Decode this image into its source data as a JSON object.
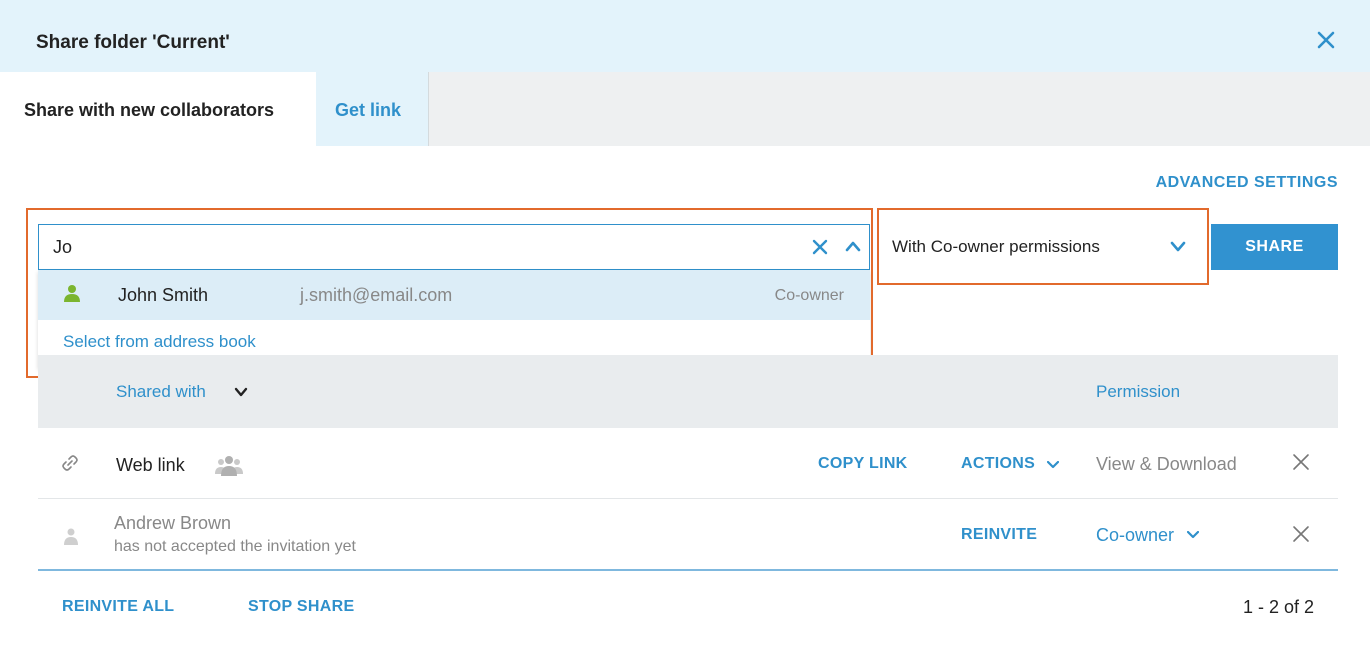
{
  "dialog": {
    "title": "Share folder 'Current'",
    "close_icon": "close-icon"
  },
  "tabs": [
    {
      "label": "Share with new collaborators",
      "active": true
    },
    {
      "label": "Get link",
      "active": false
    }
  ],
  "advanced_settings_label": "ADVANCED SETTINGS",
  "search": {
    "value": "Jo",
    "placeholder": "",
    "clear_icon": "clear-icon",
    "collapse_icon": "chevron-up-icon"
  },
  "suggestions": [
    {
      "name": "John Smith",
      "email": "j.smith@email.com",
      "role": "Co-owner",
      "icon": "person-icon"
    }
  ],
  "address_book_label": "Select from address book",
  "permission_select": {
    "value": "With Co-owner permissions",
    "icon": "chevron-down-icon"
  },
  "share_button_label": "SHARE",
  "table": {
    "headers": {
      "shared_with": "Shared with",
      "permission": "Permission"
    },
    "rows": [
      {
        "name": "Web link",
        "icon": "link-icon",
        "action1": "COPY LINK",
        "action2": "ACTIONS",
        "permission": "View & Download"
      },
      {
        "name": "Andrew Brown",
        "status": "has not accepted the invitation yet",
        "icon": "person-icon",
        "action1": "REINVITE",
        "permission": "Co-owner"
      }
    ]
  },
  "footer": {
    "reinvite_all": "REINVITE ALL",
    "stop_share": "STOP SHARE",
    "pagination": "1 - 2 of 2"
  },
  "colors": {
    "accent": "#2f90cb",
    "header_bg": "#e3f3fb",
    "highlight": "#e26a2c",
    "person_green": "#7bb52f"
  }
}
